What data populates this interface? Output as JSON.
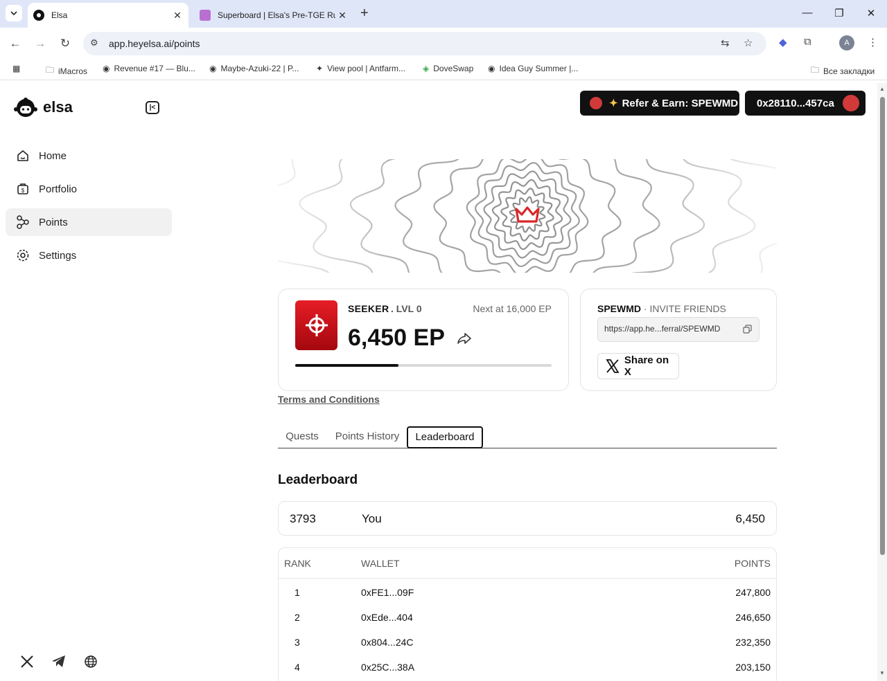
{
  "browser": {
    "tabs": [
      {
        "title": "Elsa",
        "active": true
      },
      {
        "title": "Superboard | Elsa's Pre-TGE Rus",
        "active": false
      }
    ],
    "url": "app.heyelsa.ai/points",
    "profile_initial": "A",
    "bookmarks": [
      {
        "label": "iMacros",
        "icon": "folder-icon"
      },
      {
        "label": "Revenue #17 — Blu...",
        "icon": "eye-icon"
      },
      {
        "label": "Maybe-Azuki-22 | P...",
        "icon": "eye-icon"
      },
      {
        "label": "View pool | Antfarm...",
        "icon": "diamond-icon"
      },
      {
        "label": "DoveSwap",
        "icon": "dove-icon"
      },
      {
        "label": "Idea Guy Summer |...",
        "icon": "eye-icon"
      }
    ],
    "all_bookmarks": "Все закладки"
  },
  "app": {
    "brand": "elsa",
    "nav": [
      {
        "label": "Home",
        "icon": "home-icon",
        "active": false
      },
      {
        "label": "Portfolio",
        "icon": "portfolio-icon",
        "active": false
      },
      {
        "label": "Points",
        "icon": "points-icon",
        "active": true
      },
      {
        "label": "Settings",
        "icon": "gear-icon",
        "active": false
      }
    ],
    "header": {
      "refer_label": "Refer & Earn: SPEWMD",
      "wallet_label": "0x28110...457ca"
    },
    "points": {
      "tier": "SEEKER",
      "level": ". LVL 0",
      "next_label": "Next at 16,000 EP",
      "ep_value": "6,450 EP",
      "progress_fraction": 0.403
    },
    "invite": {
      "code": "SPEWMD",
      "title_suffix": " · INVITE FRIENDS",
      "link": "https://app.he...ferral/SPEWMD",
      "share_label": "Share on X"
    },
    "terms": "Terms and Conditions",
    "tabs": [
      "Quests",
      "Points History",
      "Leaderboard"
    ],
    "active_tab": "Leaderboard",
    "leaderboard": {
      "title": "Leaderboard",
      "you": {
        "rank": "3793",
        "name": "You",
        "points": "6,450"
      },
      "columns": [
        "RANK",
        "WALLET",
        "POINTS"
      ],
      "rows": [
        {
          "rank": "1",
          "wallet": "0xFE1...09F",
          "points": "247,800"
        },
        {
          "rank": "2",
          "wallet": "0xEde...404",
          "points": "246,650"
        },
        {
          "rank": "3",
          "wallet": "0x804...24C",
          "points": "232,350"
        },
        {
          "rank": "4",
          "wallet": "0x25C...38A",
          "points": "203,150"
        }
      ]
    }
  }
}
